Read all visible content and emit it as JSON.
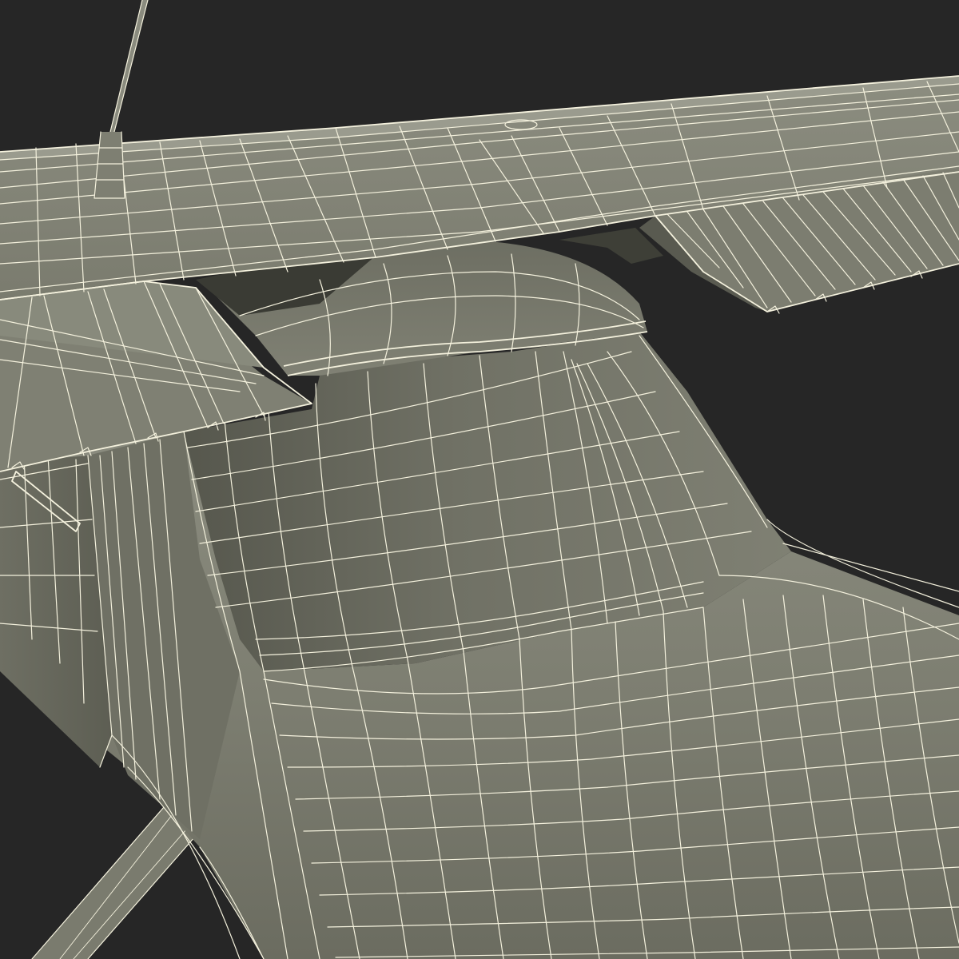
{
  "scene": {
    "subject": "aircraft-wireframe-render",
    "colors": {
      "background": "#262626",
      "surface_light": "#87887b",
      "surface_mid": "#76776a",
      "surface_dark": "#5a5b51",
      "surface_shadow": "#45463e",
      "wire": "#f4f1dd"
    }
  }
}
